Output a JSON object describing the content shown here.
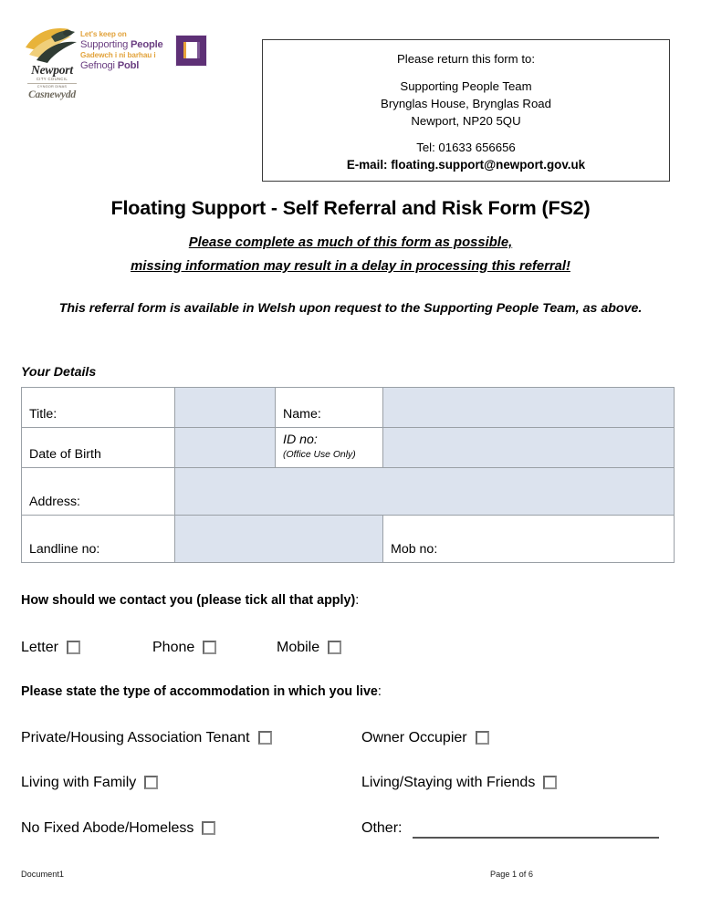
{
  "logo": {
    "council_name": "Newport",
    "council_sub_en": "CITY COUNCIL",
    "council_sub_cy": "CYNGOR DINAS",
    "council_name_cy": "Casnewydd",
    "bird_icon": "newport-wing-icon",
    "campaign": {
      "tagline_en": "Let's keep on",
      "title_en_light": "Supporting ",
      "title_en_bold": "People",
      "tagline_cy": "Gadewch i ni barhau i",
      "title_cy_light": "Gefnogi ",
      "title_cy_bold": "Pobl",
      "icon": "supporting-people-door-icon"
    },
    "colors": {
      "gold": "#e2a33c",
      "purple": "#6b3f82",
      "icon_purple": "#5e3076"
    }
  },
  "return_box": {
    "intro": "Please return this form to:",
    "team": "Supporting People Team",
    "address_line1": "Brynglas House, Brynglas Road",
    "address_line2": "Newport, NP20 5QU",
    "tel": "Tel:  01633 656656",
    "email": "E-mail:  floating.support@newport.gov.uk"
  },
  "document": {
    "title": "Floating Support - Self Referral and Risk Form (FS2)",
    "subtitle_line1": "Please complete as much of this form as possible,",
    "subtitle_line2": "missing information may result in a delay in processing this referral!",
    "welsh_note": "This referral form is available in Welsh upon request to the Supporting People Team, as above."
  },
  "your_details": {
    "heading": "Your Details",
    "rows": [
      {
        "label_left": "Title:",
        "label_mid": "Name:"
      },
      {
        "label_left": "Date of Birth",
        "label_mid": "ID no:",
        "label_mid_note": "(Office Use Only)"
      },
      {
        "label_left": "Address:"
      },
      {
        "label_left": "Landline no:",
        "label_mid": "Mob no:"
      }
    ]
  },
  "contact_question": {
    "heading_bold": "How should we contact you (please tick all that apply)",
    "heading_colon": ":",
    "options": [
      {
        "label": "Letter",
        "checked": false
      },
      {
        "label": "Phone",
        "checked": false
      },
      {
        "label": "Mobile",
        "checked": false
      }
    ]
  },
  "accommodation_question": {
    "heading_bold": "Please state the type of accommodation in which you live",
    "heading_colon": ":",
    "options": [
      {
        "label": "Private/Housing Association Tenant",
        "checked": false
      },
      {
        "label": "Owner Occupier",
        "checked": false
      },
      {
        "label": "Living with Family",
        "checked": false
      },
      {
        "label": "Living/Staying with Friends",
        "checked": false
      },
      {
        "label": "No Fixed Abode/Homeless",
        "checked": false
      }
    ],
    "other_label": "Other:",
    "other_value": ""
  },
  "footer": {
    "left": "Document1",
    "right": "Page 1 of 6"
  },
  "colors": {
    "field_fill": "#dce3ee",
    "table_border": "#9aa0a6",
    "box_border": "#3a3a3a"
  }
}
